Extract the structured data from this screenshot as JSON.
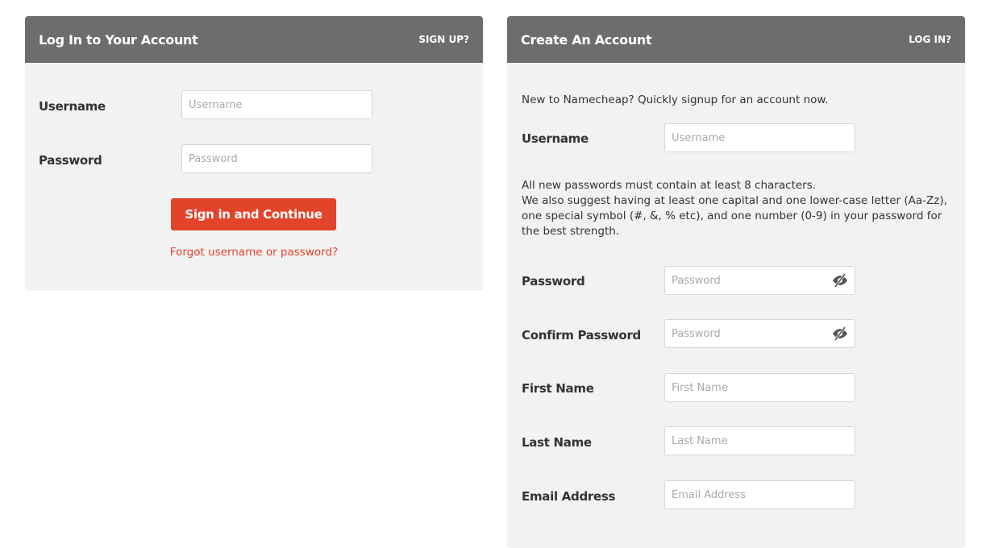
{
  "login": {
    "title": "Log In to Your Account",
    "header_link": "SIGN UP?",
    "username_label": "Username",
    "username_placeholder": "Username",
    "password_label": "Password",
    "password_placeholder": "Password",
    "submit_label": "Sign in and Continue",
    "forgot_link": "Forgot username or password?"
  },
  "signup": {
    "title": "Create An Account",
    "header_link": "LOG IN?",
    "intro": "New to Namecheap? Quickly signup for an account now.",
    "username_label": "Username",
    "username_placeholder": "Username",
    "password_rules_1": "All new passwords must contain at least 8 characters.",
    "password_rules_2": "We also suggest having at least one capital and one lower-case letter (Aa-Zz), one special symbol (#, &, % etc), and one number (0-9) in your password for the best strength.",
    "password_label": "Password",
    "password_placeholder": "Password",
    "confirm_label": "Confirm Password",
    "confirm_placeholder": "Password",
    "first_name_label": "First Name",
    "first_name_placeholder": "First Name",
    "last_name_label": "Last Name",
    "last_name_placeholder": "Last Name",
    "email_label": "Email Address",
    "email_placeholder": "Email Address"
  },
  "icons": {
    "password_toggle": "eye-slash-icon"
  },
  "colors": {
    "header_bg": "#6d6d6d",
    "panel_bg": "#f2f2f2",
    "accent": "#e2432b"
  }
}
